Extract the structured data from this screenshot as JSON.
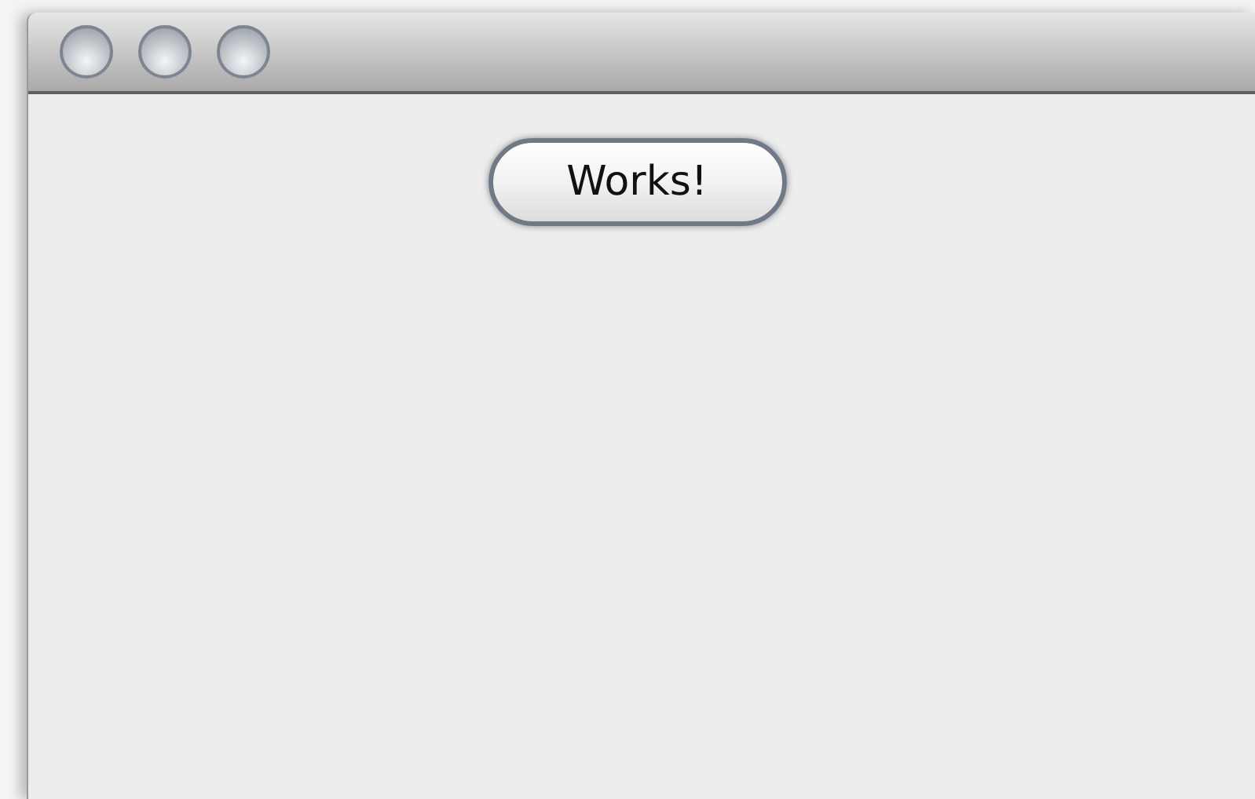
{
  "button": {
    "label": "Works!"
  }
}
